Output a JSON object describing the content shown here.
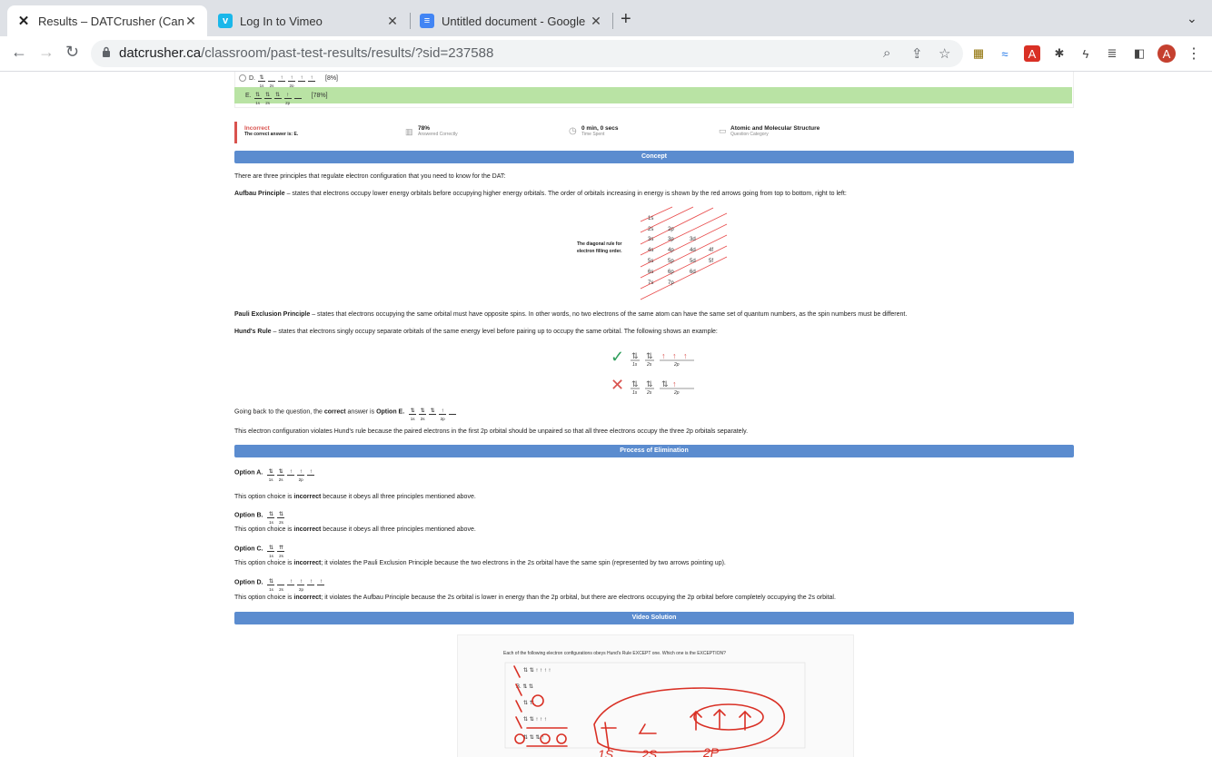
{
  "tabs": [
    {
      "title": "Results – DATCrusher (Canadian",
      "active": true,
      "icon": "datcrusher-x-icon"
    },
    {
      "title": "Log In to Vimeo",
      "active": false,
      "icon": "vimeo-icon"
    },
    {
      "title": "Untitled document - Google Docs",
      "active": false,
      "icon": "google-docs-icon"
    }
  ],
  "omnibox": {
    "domain": "datcrusher.ca",
    "path": "/classroom/past-test-results/results/?sid=237588"
  },
  "profile_initial": "A",
  "options_shown": [
    {
      "letter": "D.",
      "pct": "[8%]",
      "correct": false
    },
    {
      "letter": "E.",
      "pct": "[78%]",
      "correct": true
    }
  ],
  "result": {
    "status": "Incorrect",
    "correct_answer": "The correct answer is: E.",
    "answered_pct": "78%",
    "answered_label": "Answered Correctly",
    "time": "0 min, 0 secs",
    "time_label": "Time Spent",
    "category": "Atomic and Molecular Structure",
    "category_label": "Question Category"
  },
  "orbital_labels": {
    "s1": "1s",
    "s2": "2s",
    "p2": "2p"
  },
  "concept": {
    "banner": "Concept",
    "intro": "There are three principles that regulate electron configuration that you need to know for the DAT:",
    "aufbau_title": "Aufbau Principle",
    "aufbau_text": " – states that electrons occupy lower energy orbitals before occupying higher energy orbitals. The order of orbitals increasing in energy is shown by the red arrows going from top to bottom, right to left:",
    "diagram_label": "The diagonal rule for electron filling order.",
    "diagram_orbitals": [
      [
        "1s"
      ],
      [
        "2s",
        "2p"
      ],
      [
        "3s",
        "3p",
        "3d"
      ],
      [
        "4s",
        "4p",
        "4d",
        "4f"
      ],
      [
        "5s",
        "5p",
        "5d",
        "5f"
      ],
      [
        "6s",
        "6p",
        "6d"
      ],
      [
        "7s",
        "7p"
      ]
    ],
    "pauli_title": "Pauli Exclusion Principle",
    "pauli_text": " – states that electrons occupying the same orbital must have opposite spins. In other words, no two electrons of the same atom can have the same set of quantum numbers, as the spin numbers must be different.",
    "hund_title": "Hund's Rule",
    "hund_text": " – states that electrons singly occupy separate orbitals of the same energy level before pairing up to occupy the same orbital. The following shows an example:",
    "back_pre": "Going back to the question, the ",
    "back_correct": "correct",
    "back_mid": " answer is ",
    "back_option": "Option E.",
    "violation": "This electron configuration violates Hund's rule because the paired electrons in the first 2p orbital should be unpaired so that all three electrons occupy the three 2p orbitals separately."
  },
  "elimination": {
    "banner": "Process of Elimination",
    "option_a": "Option A.",
    "option_a_text_pre": "This option choice is ",
    "option_a_bold": "incorrect",
    "option_a_text_post": " because it obeys all three principles mentioned above.",
    "option_b": "Option B.",
    "option_b_text_pre": "This option choice is ",
    "option_b_bold": "incorrect",
    "option_b_text_post": " because it obeys all three principles mentioned above.",
    "option_c": "Option C.",
    "option_c_text_pre": "This option choice is ",
    "option_c_bold": "incorrect",
    "option_c_text_post": "; it violates the Pauli Exclusion Principle because the two electrons in the 2s orbital have the same spin (represented by two arrows pointing up).",
    "option_d": "Option D.",
    "option_d_text_pre": "This option choice is ",
    "option_d_bold": "incorrect",
    "option_d_text_post": "; it violates the Aufbau Principle because the 2s orbital is lower in energy than the 2p orbital, but there are electrons occupying the 2p orbital before completely occupying the 2s orbital."
  },
  "video": {
    "banner": "Video Solution",
    "question": "Each of the following electron configurations obeys Hund's Rule EXCEPT one. Which one is the EXCEPTION?",
    "handwritten": [
      "1S",
      "2S",
      "2P"
    ]
  }
}
